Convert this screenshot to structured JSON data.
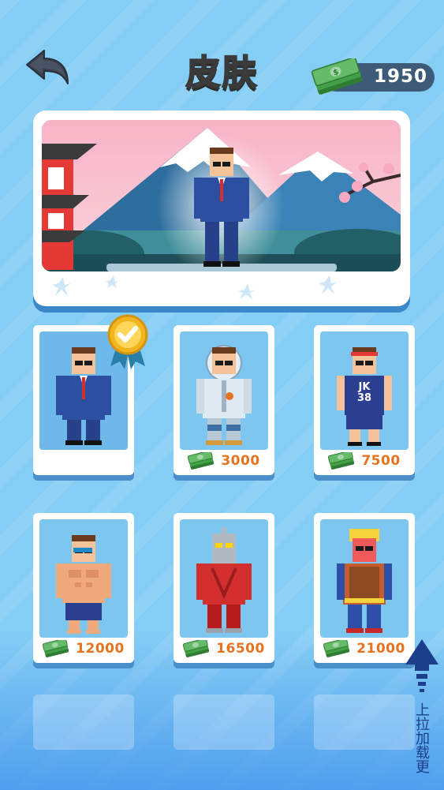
{
  "header": {
    "title": "皮肤",
    "coins": "1950",
    "back_icon": "back-arrow-icon",
    "coin_icon": "cash-stack-icon"
  },
  "preview": {
    "character": "suit-agent",
    "background": "mountain-pagoda-sakura"
  },
  "skins": [
    {
      "name": "suit-agent",
      "price": "",
      "selected": true
    },
    {
      "name": "astronaut",
      "price": "3000",
      "selected": false
    },
    {
      "name": "basketball-player",
      "price": "7500",
      "selected": false,
      "jersey": "JK 38"
    },
    {
      "name": "bodybuilder",
      "price": "12000",
      "selected": false
    },
    {
      "name": "ultra-hero",
      "price": "16500",
      "selected": false
    },
    {
      "name": "blonde-soldier",
      "price": "21000",
      "selected": false
    }
  ],
  "pull_up": {
    "label": "上拉加载更"
  },
  "colors": {
    "price": "#e8731e",
    "card_shadow": "#4a8fc9",
    "background": "#84cdf5",
    "selected_badge": "#f2b51d"
  }
}
